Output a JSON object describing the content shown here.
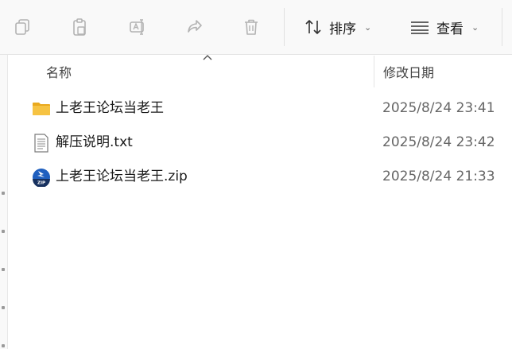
{
  "toolbar": {
    "sort_label": "排序",
    "view_label": "查看"
  },
  "columns": {
    "name": "名称",
    "modified": "修改日期"
  },
  "files": [
    {
      "name": "上老王论坛当老王",
      "date": "2025/8/24 23:41",
      "icon": "folder-icon"
    },
    {
      "name": "解压说明.txt",
      "date": "2025/8/24 23:42",
      "icon": "text-file-icon"
    },
    {
      "name": "上老王论坛当老王.zip",
      "date": "2025/8/24 21:33",
      "icon": "zip-archive-icon"
    }
  ],
  "colors": {
    "toolbar_bg": "#f9f9f9",
    "folder": "#f6c343",
    "zip_blue": "#1f5fbf"
  }
}
